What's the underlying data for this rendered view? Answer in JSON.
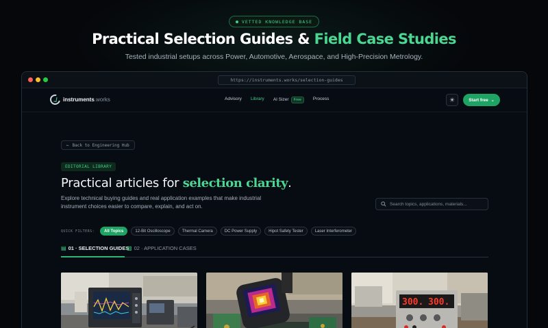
{
  "hero": {
    "badge": "VETTED KNOWLEDGE BASE",
    "title_main": "Practical Selection Guides & ",
    "title_accent": "Field Case Studies",
    "subtitle": "Tested industrial setups across Power, Automotive, Aerospace, and High-Precision Metrology."
  },
  "browser": {
    "url": "https://instruments.works/selection-guides"
  },
  "nav": {
    "brand": "instruments",
    "brand_tld": ".works",
    "links": [
      "Advisory",
      "Library",
      "AI Sizer",
      "Process"
    ],
    "active_link": "Library",
    "free_badge": "Free",
    "cta": "Start free"
  },
  "content": {
    "back_label": "Back to Engineering Hub",
    "eyebrow": "EDITORIAL LIBRARY",
    "title_prefix": "Practical articles for ",
    "title_accent": "selection clarity",
    "title_suffix": ".",
    "description": "Explore technical buying guides and real application examples that make industrial instrument choices easier to compare, explain, and act on.",
    "search_placeholder": "Search topics, applications, materials..."
  },
  "filters": {
    "label": "QUICK FILTERS:",
    "chips": [
      "All Topics",
      "12-Bit Oscilloscope",
      "Thermal Camera",
      "DC Power Supply",
      "Hipot Safety Tester",
      "Laser Interferometer"
    ],
    "active": "All Topics"
  },
  "tabs": [
    {
      "label": "01 · SELECTION GUIDES",
      "active": true
    },
    {
      "label": "02 · APPLICATION CASES",
      "active": false
    }
  ],
  "cards": [
    {
      "image": "oscilloscope-bench-photo"
    },
    {
      "image": "thermal-camera-photo"
    },
    {
      "image": "dc-power-supply-photo",
      "display_left": "300.",
      "display_right": "300."
    }
  ],
  "colors": {
    "accent": "#4cd694",
    "cta_bg": "#1fa364",
    "background": "#05070b"
  }
}
